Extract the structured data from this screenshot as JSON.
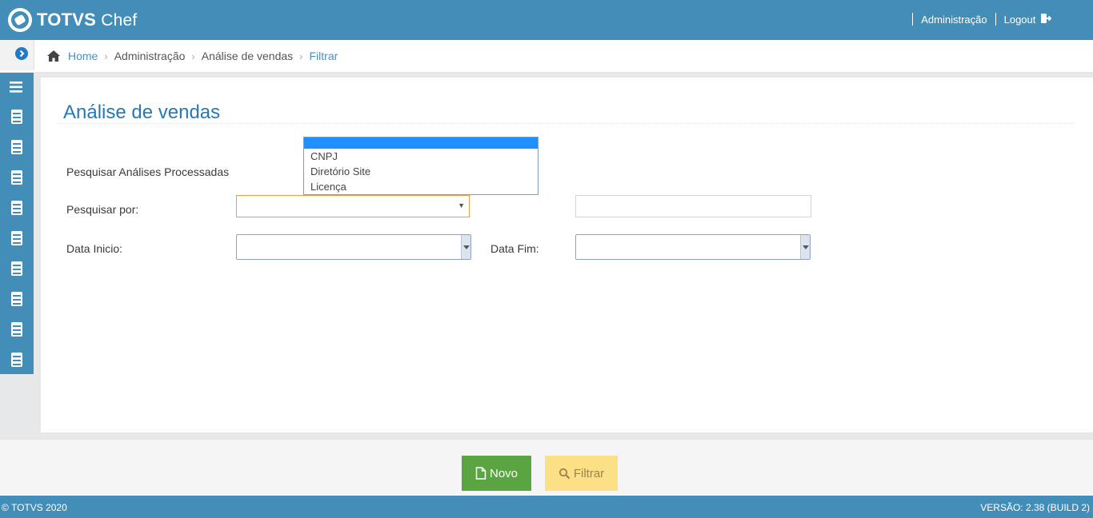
{
  "brand": {
    "name_bold": "TOTVS",
    "name_light": "Chef"
  },
  "topnav": {
    "admin": "Administração",
    "logout": "Logout"
  },
  "breadcrumb": {
    "home": "Home",
    "admin": "Administração",
    "analise": "Análise de vendas",
    "current": "Filtrar"
  },
  "sidebar": {
    "items": [
      "menu-icon",
      "module-icon",
      "module-icon",
      "module-icon",
      "module-icon",
      "module-icon",
      "module-icon",
      "module-icon",
      "module-icon",
      "module-icon"
    ]
  },
  "page": {
    "title": "Análise de vendas",
    "search_processed_label": "Pesquisar Análises Processadas",
    "search_by_label": "Pesquisar por:",
    "search_by_value": "",
    "search_text_value": "",
    "date_start_label": "Data Inicio:",
    "date_end_label": "Data Fim:",
    "dropdown_options": [
      "",
      "CNPJ",
      "Diretório Site",
      "Licença"
    ]
  },
  "actions": {
    "novo": "Novo",
    "filtrar": "Filtrar"
  },
  "footer": {
    "copyright": "© TOTVS 2020",
    "version": "VERSÃO: 2.38 (BUILD 2)"
  },
  "colors": {
    "primary": "#438eb9",
    "accent": "#2679b5",
    "success": "#5aa541",
    "warning": "#fde085",
    "focus": "#f59942"
  }
}
